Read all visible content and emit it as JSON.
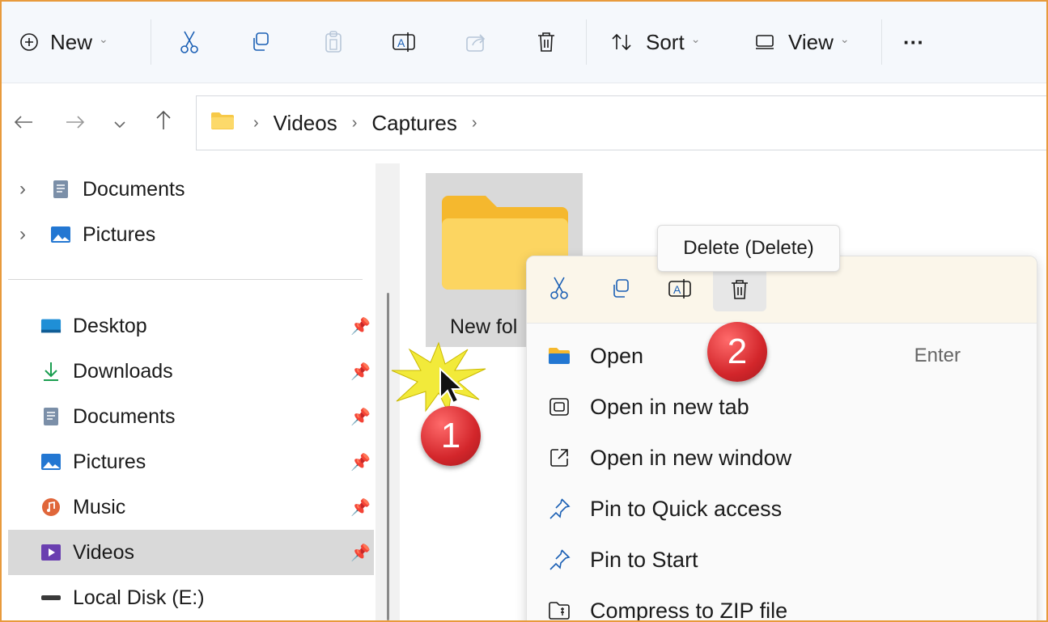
{
  "toolbar": {
    "new_label": "New",
    "sort_label": "Sort",
    "view_label": "View",
    "more_label": "···"
  },
  "breadcrumb": {
    "items": [
      "Videos",
      "Captures"
    ],
    "sep": "›"
  },
  "sidebar": {
    "tree": [
      {
        "label": "Documents",
        "expand": "›"
      },
      {
        "label": "Pictures",
        "expand": "›"
      }
    ],
    "quick": [
      {
        "label": "Desktop"
      },
      {
        "label": "Downloads"
      },
      {
        "label": "Documents"
      },
      {
        "label": "Pictures"
      },
      {
        "label": "Music"
      },
      {
        "label": "Videos"
      },
      {
        "label": "Local Disk (E:)"
      }
    ]
  },
  "content": {
    "folder_label": "New fol"
  },
  "tooltip": {
    "text": "Delete (Delete)"
  },
  "context_menu": {
    "items": [
      {
        "label": "Open",
        "shortcut": "Enter"
      },
      {
        "label": "Open in new tab"
      },
      {
        "label": "Open in new window"
      },
      {
        "label": "Pin to Quick access"
      },
      {
        "label": "Pin to Start"
      },
      {
        "label": "Compress to ZIP file"
      }
    ]
  },
  "annotations": {
    "step1": "1",
    "step2": "2"
  },
  "colors": {
    "frame": "#e89a3c",
    "accent": "#0067c0",
    "selection": "#d9d9d9",
    "badge": "#d3262b"
  }
}
